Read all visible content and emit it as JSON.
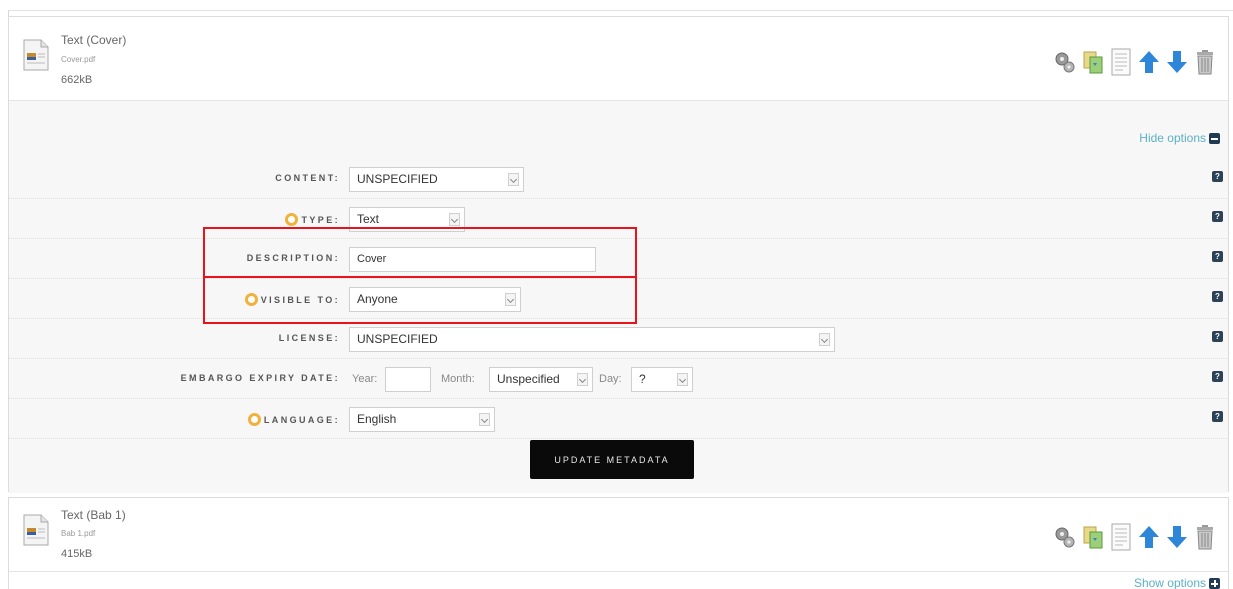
{
  "files": [
    {
      "title": "Text (Cover)",
      "filename": "Cover.pdf",
      "size": "662kB",
      "options_link": "Hide options"
    },
    {
      "title": "Text (Bab 1)",
      "filename": "Bab 1.pdf",
      "size": "415kB",
      "options_link": "Show options"
    }
  ],
  "form": {
    "content": {
      "label": "CONTENT:",
      "value": "UNSPECIFIED"
    },
    "type": {
      "label": "TYPE:",
      "value": "Text"
    },
    "description": {
      "label": "DESCRIPTION:",
      "value": "Cover"
    },
    "visible_to": {
      "label": "VISIBLE TO:",
      "value": "Anyone"
    },
    "license": {
      "label": "LICENSE:",
      "value": "UNSPECIFIED"
    },
    "embargo": {
      "label": "EMBARGO EXPIRY DATE:",
      "year_label": "Year:",
      "year_value": "",
      "month_label": "Month:",
      "month_value": "Unspecified",
      "day_label": "Day:",
      "day_value": "?"
    },
    "language": {
      "label": "LANGUAGE:",
      "value": "English"
    },
    "help_glyph": "?",
    "update_button": "UPDATE METADATA"
  },
  "icons": {
    "tools": [
      "gears-icon",
      "convert-icon",
      "document-icon",
      "arrow-up-icon",
      "arrow-down-icon",
      "trash-icon"
    ],
    "required": "required-ring-icon",
    "help": "help-icon"
  },
  "colors": {
    "highlight": "#e8141c",
    "link": "#5bb1c4",
    "required_ring": "#f0b23c",
    "arrow_blue": "#2e86d8",
    "button_bg": "#0a0a0a"
  }
}
